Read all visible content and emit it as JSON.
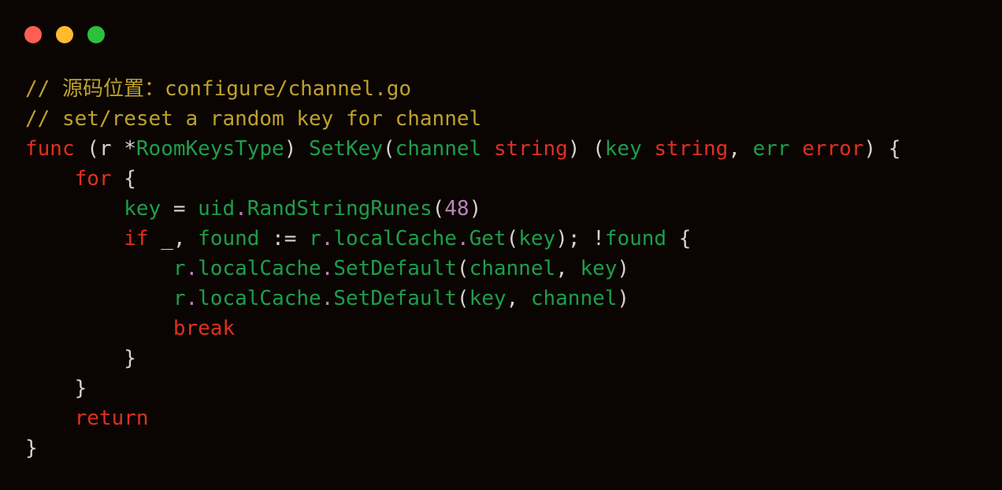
{
  "window": {
    "title": "",
    "background": "#0a0503",
    "traffic_lights": [
      {
        "name": "close",
        "color": "#FF5F52"
      },
      {
        "name": "minimize",
        "color": "#FFBB2D"
      },
      {
        "name": "maximize",
        "color": "#2CC03C"
      }
    ]
  },
  "theme": {
    "comment": "#BFA12C",
    "keyword": "#E03020",
    "plain": "#D8D2CC",
    "identifier": "#1E9E4A",
    "type": "#E03020",
    "number": "#BD83B8",
    "punct_dot": "#BD83B8"
  },
  "code": {
    "language": "go",
    "plain_text": "// 源码位置：configure/channel.go\n// set/reset a random key for channel\nfunc (r *RoomKeysType) SetKey(channel string) (key string, err error) {\n    for {\n        key = uid.RandStringRunes(48)\n        if _, found := r.localCache.Get(key); !found {\n            r.localCache.SetDefault(channel, key)\n            r.localCache.SetDefault(key, channel)\n            break\n        }\n    }\n    return\n}",
    "lines": [
      {
        "n": 1,
        "tokens": [
          {
            "t": "// 源码位置：configure/channel.go",
            "c": "com"
          }
        ]
      },
      {
        "n": 2,
        "tokens": [
          {
            "t": "// set/reset a random key for channel",
            "c": "com"
          }
        ]
      },
      {
        "n": 3,
        "tokens": [
          {
            "t": "func",
            "c": "kw"
          },
          {
            "t": " ",
            "c": "plain"
          },
          {
            "t": "(",
            "c": "plain"
          },
          {
            "t": "r",
            "c": "plain"
          },
          {
            "t": " ",
            "c": "plain"
          },
          {
            "t": "*",
            "c": "plain"
          },
          {
            "t": "RoomKeysType",
            "c": "id"
          },
          {
            "t": ") ",
            "c": "plain"
          },
          {
            "t": "SetKey",
            "c": "id"
          },
          {
            "t": "(",
            "c": "plain"
          },
          {
            "t": "channel",
            "c": "id"
          },
          {
            "t": " ",
            "c": "plain"
          },
          {
            "t": "string",
            "c": "typ"
          },
          {
            "t": ") (",
            "c": "plain"
          },
          {
            "t": "key",
            "c": "id"
          },
          {
            "t": " ",
            "c": "plain"
          },
          {
            "t": "string",
            "c": "typ"
          },
          {
            "t": ", ",
            "c": "plain"
          },
          {
            "t": "err",
            "c": "id"
          },
          {
            "t": " ",
            "c": "plain"
          },
          {
            "t": "error",
            "c": "typ"
          },
          {
            "t": ") {",
            "c": "plain"
          }
        ]
      },
      {
        "n": 4,
        "tokens": [
          {
            "t": "    ",
            "c": "plain"
          },
          {
            "t": "for",
            "c": "kw"
          },
          {
            "t": " {",
            "c": "plain"
          }
        ]
      },
      {
        "n": 5,
        "tokens": [
          {
            "t": "        ",
            "c": "plain"
          },
          {
            "t": "key",
            "c": "id"
          },
          {
            "t": " = ",
            "c": "plain"
          },
          {
            "t": "uid",
            "c": "id"
          },
          {
            "t": ".",
            "c": "dot"
          },
          {
            "t": "RandStringRunes",
            "c": "id"
          },
          {
            "t": "(",
            "c": "plain"
          },
          {
            "t": "48",
            "c": "num"
          },
          {
            "t": ")",
            "c": "plain"
          }
        ]
      },
      {
        "n": 6,
        "tokens": [
          {
            "t": "        ",
            "c": "plain"
          },
          {
            "t": "if",
            "c": "kw"
          },
          {
            "t": " _, ",
            "c": "plain"
          },
          {
            "t": "found",
            "c": "id"
          },
          {
            "t": " := ",
            "c": "plain"
          },
          {
            "t": "r",
            "c": "id"
          },
          {
            "t": ".",
            "c": "dot"
          },
          {
            "t": "localCache",
            "c": "id"
          },
          {
            "t": ".",
            "c": "dot"
          },
          {
            "t": "Get",
            "c": "id"
          },
          {
            "t": "(",
            "c": "plain"
          },
          {
            "t": "key",
            "c": "id"
          },
          {
            "t": "); !",
            "c": "plain"
          },
          {
            "t": "found",
            "c": "id"
          },
          {
            "t": " {",
            "c": "plain"
          }
        ]
      },
      {
        "n": 7,
        "tokens": [
          {
            "t": "            ",
            "c": "plain"
          },
          {
            "t": "r",
            "c": "id"
          },
          {
            "t": ".",
            "c": "dot"
          },
          {
            "t": "localCache",
            "c": "id"
          },
          {
            "t": ".",
            "c": "dot"
          },
          {
            "t": "SetDefault",
            "c": "id"
          },
          {
            "t": "(",
            "c": "plain"
          },
          {
            "t": "channel",
            "c": "id"
          },
          {
            "t": ", ",
            "c": "plain"
          },
          {
            "t": "key",
            "c": "id"
          },
          {
            "t": ")",
            "c": "plain"
          }
        ]
      },
      {
        "n": 8,
        "tokens": [
          {
            "t": "            ",
            "c": "plain"
          },
          {
            "t": "r",
            "c": "id"
          },
          {
            "t": ".",
            "c": "dot"
          },
          {
            "t": "localCache",
            "c": "id"
          },
          {
            "t": ".",
            "c": "dot"
          },
          {
            "t": "SetDefault",
            "c": "id"
          },
          {
            "t": "(",
            "c": "plain"
          },
          {
            "t": "key",
            "c": "id"
          },
          {
            "t": ", ",
            "c": "plain"
          },
          {
            "t": "channel",
            "c": "id"
          },
          {
            "t": ")",
            "c": "plain"
          }
        ]
      },
      {
        "n": 9,
        "tokens": [
          {
            "t": "            ",
            "c": "plain"
          },
          {
            "t": "break",
            "c": "kw"
          }
        ]
      },
      {
        "n": 10,
        "tokens": [
          {
            "t": "        }",
            "c": "plain"
          }
        ]
      },
      {
        "n": 11,
        "tokens": [
          {
            "t": "    }",
            "c": "plain"
          }
        ]
      },
      {
        "n": 12,
        "tokens": [
          {
            "t": "    ",
            "c": "plain"
          },
          {
            "t": "return",
            "c": "kw"
          }
        ]
      },
      {
        "n": 13,
        "tokens": [
          {
            "t": "}",
            "c": "plain"
          }
        ]
      }
    ]
  }
}
